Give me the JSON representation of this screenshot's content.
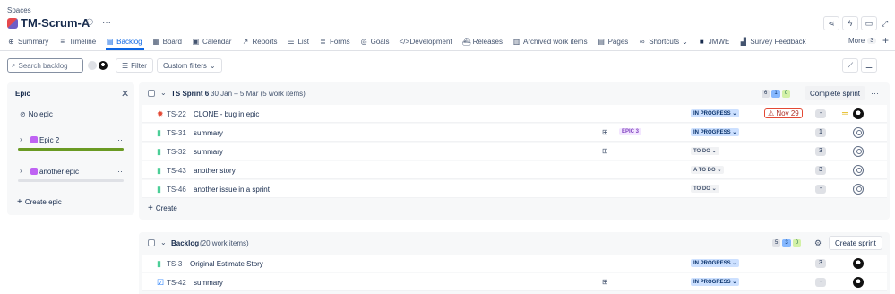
{
  "breadcrumb": "Spaces",
  "project": {
    "title": "TM-Scrum-A"
  },
  "tabs": [
    {
      "label": "Summary",
      "icon": "globe-icon"
    },
    {
      "label": "Timeline",
      "icon": "timeline-icon"
    },
    {
      "label": "Backlog",
      "icon": "backlog-icon",
      "active": true
    },
    {
      "label": "Board",
      "icon": "board-icon"
    },
    {
      "label": "Calendar",
      "icon": "calendar-icon"
    },
    {
      "label": "Reports",
      "icon": "reports-icon"
    },
    {
      "label": "List",
      "icon": "list-icon"
    },
    {
      "label": "Forms",
      "icon": "forms-icon"
    },
    {
      "label": "Goals",
      "icon": "goals-icon"
    },
    {
      "label": "Development",
      "icon": "code-icon"
    },
    {
      "label": "Releases",
      "icon": "releases-icon"
    },
    {
      "label": "Archived work items",
      "icon": "archive-icon"
    },
    {
      "label": "Pages",
      "icon": "pages-icon"
    },
    {
      "label": "Shortcuts",
      "icon": "link-icon"
    },
    {
      "label": "JMWE",
      "icon": "jmwe-icon"
    },
    {
      "label": "Survey Feedback",
      "icon": "chart-icon"
    }
  ],
  "more": {
    "label": "More",
    "count": "3"
  },
  "search": {
    "placeholder": "Search backlog"
  },
  "toolbar": {
    "filter": "Filter",
    "custom_filters": "Custom filters"
  },
  "epic_panel": {
    "title": "Epic",
    "no_epic": "No epic",
    "epics": [
      {
        "name": "Epic 2",
        "color": "#bf63f3",
        "progress": 1.0
      },
      {
        "name": "another epic",
        "color": "#bf63f3",
        "progress": 0.0
      }
    ],
    "create": "Create epic"
  },
  "sprint": {
    "name": "TS Sprint 6",
    "dates": "30 Jan – 5 Mar (5 work items)",
    "counts": [
      "6",
      "1",
      "0"
    ],
    "action": "Complete sprint",
    "create": "Create",
    "items": [
      {
        "key": "TS-22",
        "summary": "CLONE - bug in epic",
        "type": "bug",
        "status": "IN PROGRESS",
        "due": "Nov 29",
        "priority": "medium",
        "points": "",
        "assignee": "user"
      },
      {
        "key": "TS-31",
        "summary": "summary",
        "type": "story",
        "child": true,
        "epic": "EPIC 3",
        "status": "IN PROGRESS",
        "points": "1",
        "assignee": "none"
      },
      {
        "key": "TS-32",
        "summary": "summary",
        "type": "story",
        "child": true,
        "status": "TO DO",
        "points": "3",
        "assignee": "none"
      },
      {
        "key": "TS-43",
        "summary": "another story",
        "type": "story",
        "status": "A TO DO",
        "points": "3",
        "assignee": "none"
      },
      {
        "key": "TS-46",
        "summary": "another issue in a sprint",
        "type": "story",
        "status": "TO DO",
        "points": "-",
        "assignee": "none"
      }
    ]
  },
  "backlog": {
    "name": "Backlog",
    "info": "(20 work items)",
    "counts": [
      "5",
      "3",
      "0"
    ],
    "action": "Create sprint",
    "items": [
      {
        "key": "TS-3",
        "summary": "Original Estimate Story",
        "type": "story",
        "status": "IN PROGRESS",
        "points": "3",
        "assignee": "user"
      },
      {
        "key": "TS-42",
        "summary": "summary",
        "type": "task",
        "child": true,
        "status": "IN PROGRESS",
        "points": "-",
        "assignee": "user"
      }
    ]
  }
}
